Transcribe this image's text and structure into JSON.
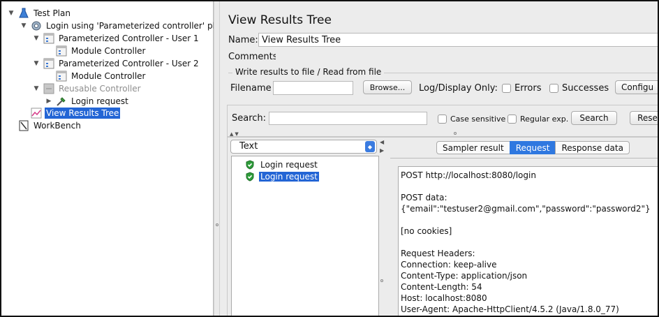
{
  "tree": {
    "items": [
      {
        "label": "Test Plan"
      },
      {
        "label": "Login using 'Parameterized controller' plugin"
      },
      {
        "label": "Parameterized Controller - User 1"
      },
      {
        "label": "Module Controller"
      },
      {
        "label": "Parameterized Controller - User 2"
      },
      {
        "label": "Module Controller"
      },
      {
        "label": "Reusable Controller"
      },
      {
        "label": "Login request"
      },
      {
        "label": "View Results Tree"
      },
      {
        "label": "WorkBench"
      }
    ]
  },
  "panel": {
    "title": "View Results Tree",
    "name_label": "Name:",
    "name_value": "View Results Tree",
    "comments_label": "Comments:",
    "write_results_title": "Write results to file / Read from file",
    "filename_label": "Filename",
    "browse_label": "Browse...",
    "log_display_label": "Log/Display Only:",
    "errors_label": "Errors",
    "successes_label": "Successes",
    "configure_label": "Configu"
  },
  "search": {
    "label": "Search:",
    "case_sensitive_label": "Case sensitive",
    "regular_exp_label": "Regular exp.",
    "search_button": "Search",
    "reset_button": "Rese"
  },
  "results": {
    "renderer": "Text",
    "items": [
      {
        "label": "Login request",
        "selected": false
      },
      {
        "label": "Login request",
        "selected": true
      }
    ],
    "tabs": [
      "Sampler result",
      "Request",
      "Response data"
    ],
    "active_tab": "Request",
    "request_text": "POST http://localhost:8080/login\n\nPOST data:\n{\"email\":\"testuser2@gmail.com\",\"password\":\"password2\"}\n\n[no cookies]\n\nRequest Headers:\nConnection: keep-alive\nContent-Type: application/json\nContent-Length: 54\nHost: localhost:8080\nUser-Agent: Apache-HttpClient/4.5.2 (Java/1.8.0_77)"
  },
  "colors": {
    "selection": "#2365d5",
    "active_tab": "#2f78e0",
    "panel_bg": "#ececec",
    "success_shield": "#2e9d3a"
  }
}
